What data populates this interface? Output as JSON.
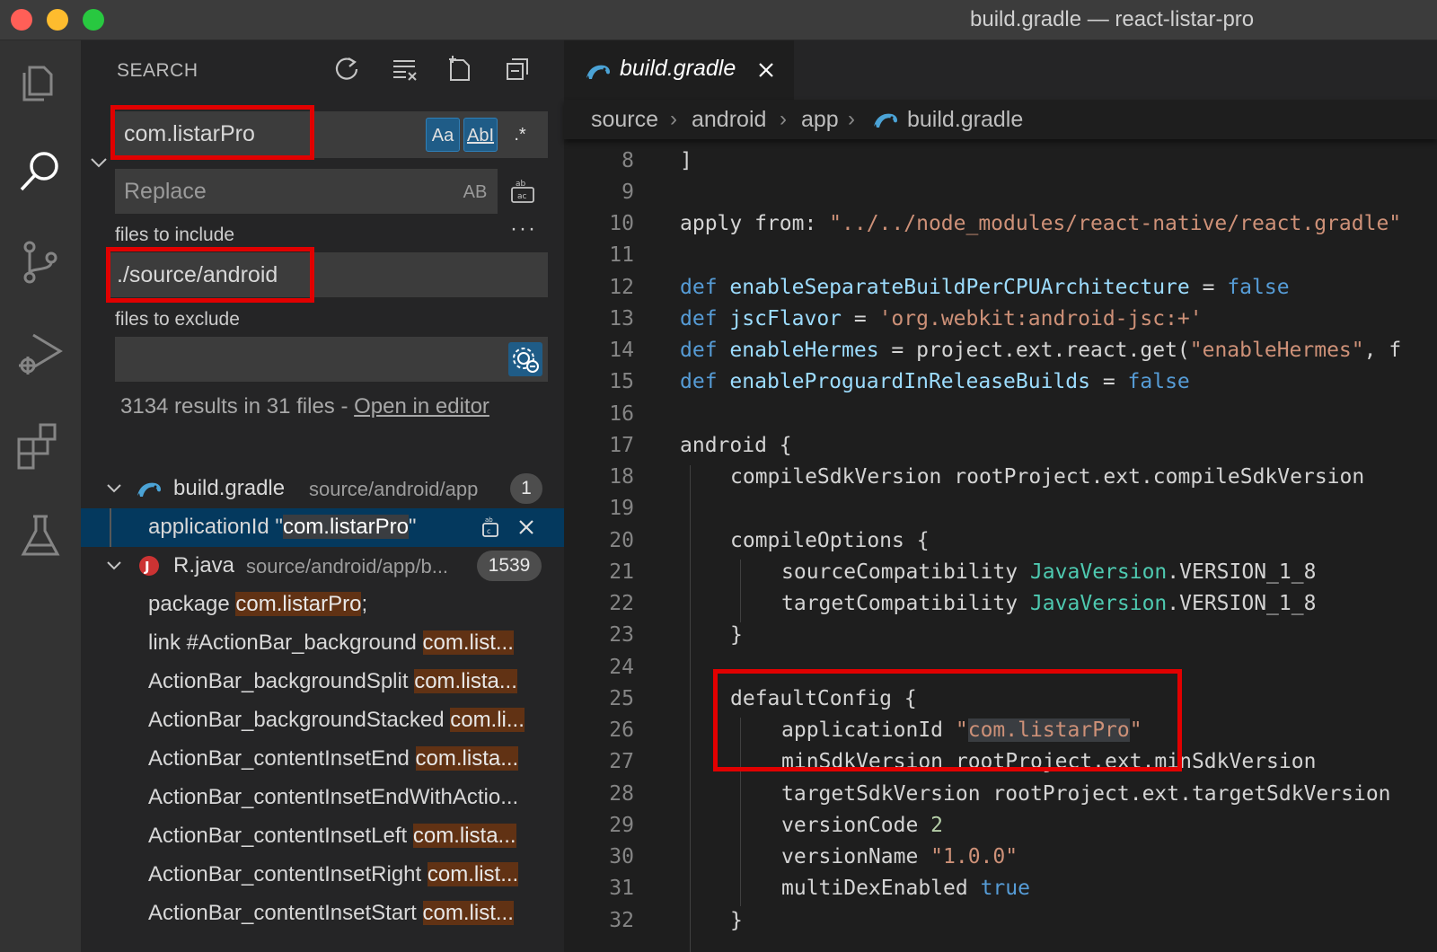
{
  "window": {
    "title": "build.gradle — react-listar-pro"
  },
  "activity_bar": {
    "items": [
      {
        "name": "explorer",
        "icon": "files-icon"
      },
      {
        "name": "search",
        "icon": "search-icon",
        "active": true
      },
      {
        "name": "source-control",
        "icon": "source-control-icon"
      },
      {
        "name": "run-debug",
        "icon": "run-debug-icon"
      },
      {
        "name": "extensions",
        "icon": "extensions-icon"
      },
      {
        "name": "testing",
        "icon": "flask-icon"
      }
    ]
  },
  "search_panel": {
    "title": "SEARCH",
    "actions": [
      "refresh-icon",
      "clear-results-icon",
      "new-search-editor-icon",
      "collapse-all-icon"
    ],
    "query": "com.listarPro",
    "match_case_label": "Aa",
    "whole_word_label": "AbI",
    "regex_label": ".*",
    "replace_placeholder": "Replace",
    "preserve_case_label": "AB",
    "more_label": "···",
    "files_to_include_label": "files to include",
    "files_to_include": "./source/android",
    "files_to_exclude_label": "files to exclude",
    "files_to_exclude": "",
    "summary": "3134 results in 31 files - ",
    "open_in_editor": "Open in editor",
    "results": {
      "file1": {
        "name": "build.gradle",
        "path": "source/android/app",
        "count": "1",
        "match": {
          "before": "applicationId \"",
          "hit": "com.listarPro",
          "after": "\""
        }
      },
      "file2": {
        "name": "R.java",
        "path": "source/android/app/b...",
        "count": "1539",
        "matches": [
          {
            "before": "package ",
            "hit": "com.listarPro",
            "after": ";"
          },
          {
            "before": "link #ActionBar_background ",
            "hit": "com.list...",
            "after": ""
          },
          {
            "before": "ActionBar_backgroundSplit ",
            "hit": "com.lista...",
            "after": ""
          },
          {
            "before": "ActionBar_backgroundStacked ",
            "hit": "com.li...",
            "after": ""
          },
          {
            "before": "ActionBar_contentInsetEnd ",
            "hit": "com.lista...",
            "after": ""
          },
          {
            "before": "ActionBar_contentInsetEndWithActio...",
            "hit": "",
            "after": ""
          },
          {
            "before": "ActionBar_contentInsetLeft ",
            "hit": "com.lista...",
            "after": ""
          },
          {
            "before": "ActionBar_contentInsetRight ",
            "hit": "com.list...",
            "after": ""
          },
          {
            "before": "ActionBar_contentInsetStart ",
            "hit": "com.list...",
            "after": ""
          }
        ]
      }
    }
  },
  "editor": {
    "tab_label": "build.gradle",
    "breadcrumb": [
      "source",
      "android",
      "app",
      "build.gradle"
    ],
    "lines": {
      "n8": "8",
      "n9": "9",
      "n10": "10",
      "n11": "11",
      "n12": "12",
      "n13": "13",
      "n14": "14",
      "n15": "15",
      "n16": "16",
      "n17": "17",
      "n18": "18",
      "n19": "19",
      "n20": "20",
      "n21": "21",
      "n22": "22",
      "n23": "23",
      "n24": "24",
      "n25": "25",
      "n26": "26",
      "n27": "27",
      "n28": "28",
      "n29": "29",
      "n30": "30",
      "n31": "31",
      "n32": "32"
    },
    "code": {
      "l7_partial": "            ",
      "l8": "]",
      "l10_a": "apply from: ",
      "l10_b": "\"../../node_modules/react-native/react.gradle\"",
      "l12_kw": "def",
      "l12_name": "enableSeparateBuildPerCPUArchitecture",
      "l12_eq": " = ",
      "l12_val": "false",
      "l13_kw": "def",
      "l13_name": "jscFlavor",
      "l13_eq": " = ",
      "l13_val": "'org.webkit:android-jsc:+'",
      "l14_kw": "def",
      "l14_name": "enableHermes",
      "l14_eq": " = project.ext.react.get(",
      "l14_str": "\"enableHermes\"",
      "l14_tail": ", f",
      "l15_kw": "def",
      "l15_name": "enableProguardInReleaseBuilds",
      "l15_eq": " = ",
      "l15_val": "false",
      "l17": "android {",
      "l18": "compileSdkVersion rootProject.ext.compileSdkVersion",
      "l20": "compileOptions {",
      "l21_a": "sourceCompatibility ",
      "l21_t": "JavaVersion",
      "l21_b": ".VERSION_1_8",
      "l22_a": "targetCompatibility ",
      "l22_t": "JavaVersion",
      "l22_b": ".VERSION_1_8",
      "l23": "}",
      "l25": "defaultConfig {",
      "l26_a": "applicationId ",
      "l26_q1": "\"",
      "l26_hit": "com.listarPro",
      "l26_q2": "\"",
      "l27": "minSdkVersion rootProject.ext.minSdkVersion",
      "l28": "targetSdkVersion rootProject.ext.targetSdkVersion",
      "l29_a": "versionCode ",
      "l29_n": "2",
      "l30_a": "versionName ",
      "l30_s": "\"1.0.0\"",
      "l31_a": "multiDexEnabled ",
      "l31_v": "true",
      "l32": "}"
    }
  },
  "colors": {
    "highlight_box": "#e10000",
    "match_bg": "#613214",
    "selected_row": "#04395e",
    "keyword": "#569cd6",
    "string": "#ce9178"
  }
}
